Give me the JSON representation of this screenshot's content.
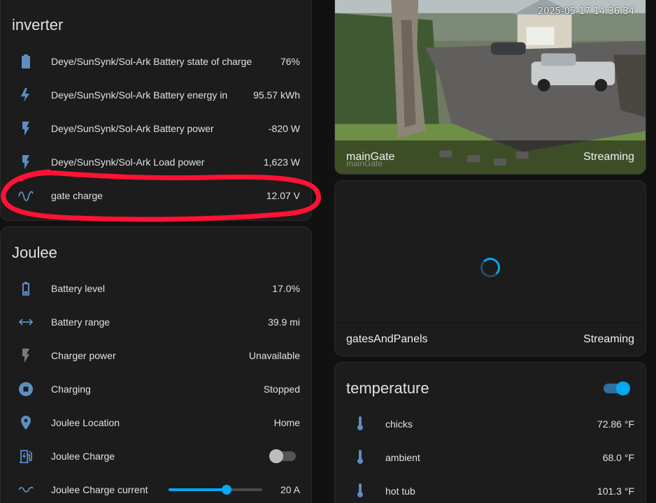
{
  "colors": {
    "icon_blue": "#5c8ec3",
    "accent": "#03a9f4",
    "annotation_red": "#ff1234",
    "card_bg": "#1c1c1c",
    "page_bg": "#111111"
  },
  "inverter": {
    "title": "inverter",
    "rows": [
      {
        "label": "Deye/SunSynk/Sol-Ark Battery state of charge",
        "value": "76%",
        "icon": "battery-icon"
      },
      {
        "label": "Deye/SunSynk/Sol-Ark Battery energy in",
        "value": "95.57 kWh",
        "icon": "lightning-bolt-icon"
      },
      {
        "label": "Deye/SunSynk/Sol-Ark Battery power",
        "value": "-820 W",
        "icon": "flash-icon"
      },
      {
        "label": "Deye/SunSynk/Sol-Ark Load power",
        "value": "1,623 W",
        "icon": "flash-icon"
      },
      {
        "label": "gate charge",
        "value": "12.07 V",
        "icon": "sine-wave-icon"
      }
    ]
  },
  "joulee": {
    "title": "Joulee",
    "rows": [
      {
        "label": "Battery level",
        "value": "17.0%",
        "icon": "battery-low-icon"
      },
      {
        "label": "Battery range",
        "value": "39.9 mi",
        "icon": "arrow-left-right-icon"
      },
      {
        "label": "Charger power",
        "value": "Unavailable",
        "icon": "flash-icon"
      },
      {
        "label": "Charging",
        "value": "Stopped",
        "icon": "stop-circle-icon"
      },
      {
        "label": "Joulee Location",
        "value": "Home",
        "icon": "map-marker-icon"
      },
      {
        "label": "Joulee Charge",
        "value": "",
        "icon": "ev-station-icon",
        "toggle": false
      },
      {
        "label": "Joulee Charge current",
        "value": "20 A",
        "icon": "current-ac-icon",
        "slider_fraction": 0.62
      }
    ]
  },
  "cameras": [
    {
      "name": "mainGate",
      "status": "Streaming",
      "timestamp": "2025-05-17 14:36:34",
      "watermark": "mainGate"
    },
    {
      "name": "gatesAndPanels",
      "status": "Streaming"
    }
  ],
  "temperature": {
    "title": "temperature",
    "toggle": true,
    "rows": [
      {
        "label": "chicks",
        "value": "72.86 °F",
        "icon": "thermometer-icon"
      },
      {
        "label": "ambient",
        "value": "68.0 °F",
        "icon": "thermometer-icon"
      },
      {
        "label": "hot tub",
        "value": "101.3 °F",
        "icon": "thermometer-icon"
      }
    ]
  }
}
